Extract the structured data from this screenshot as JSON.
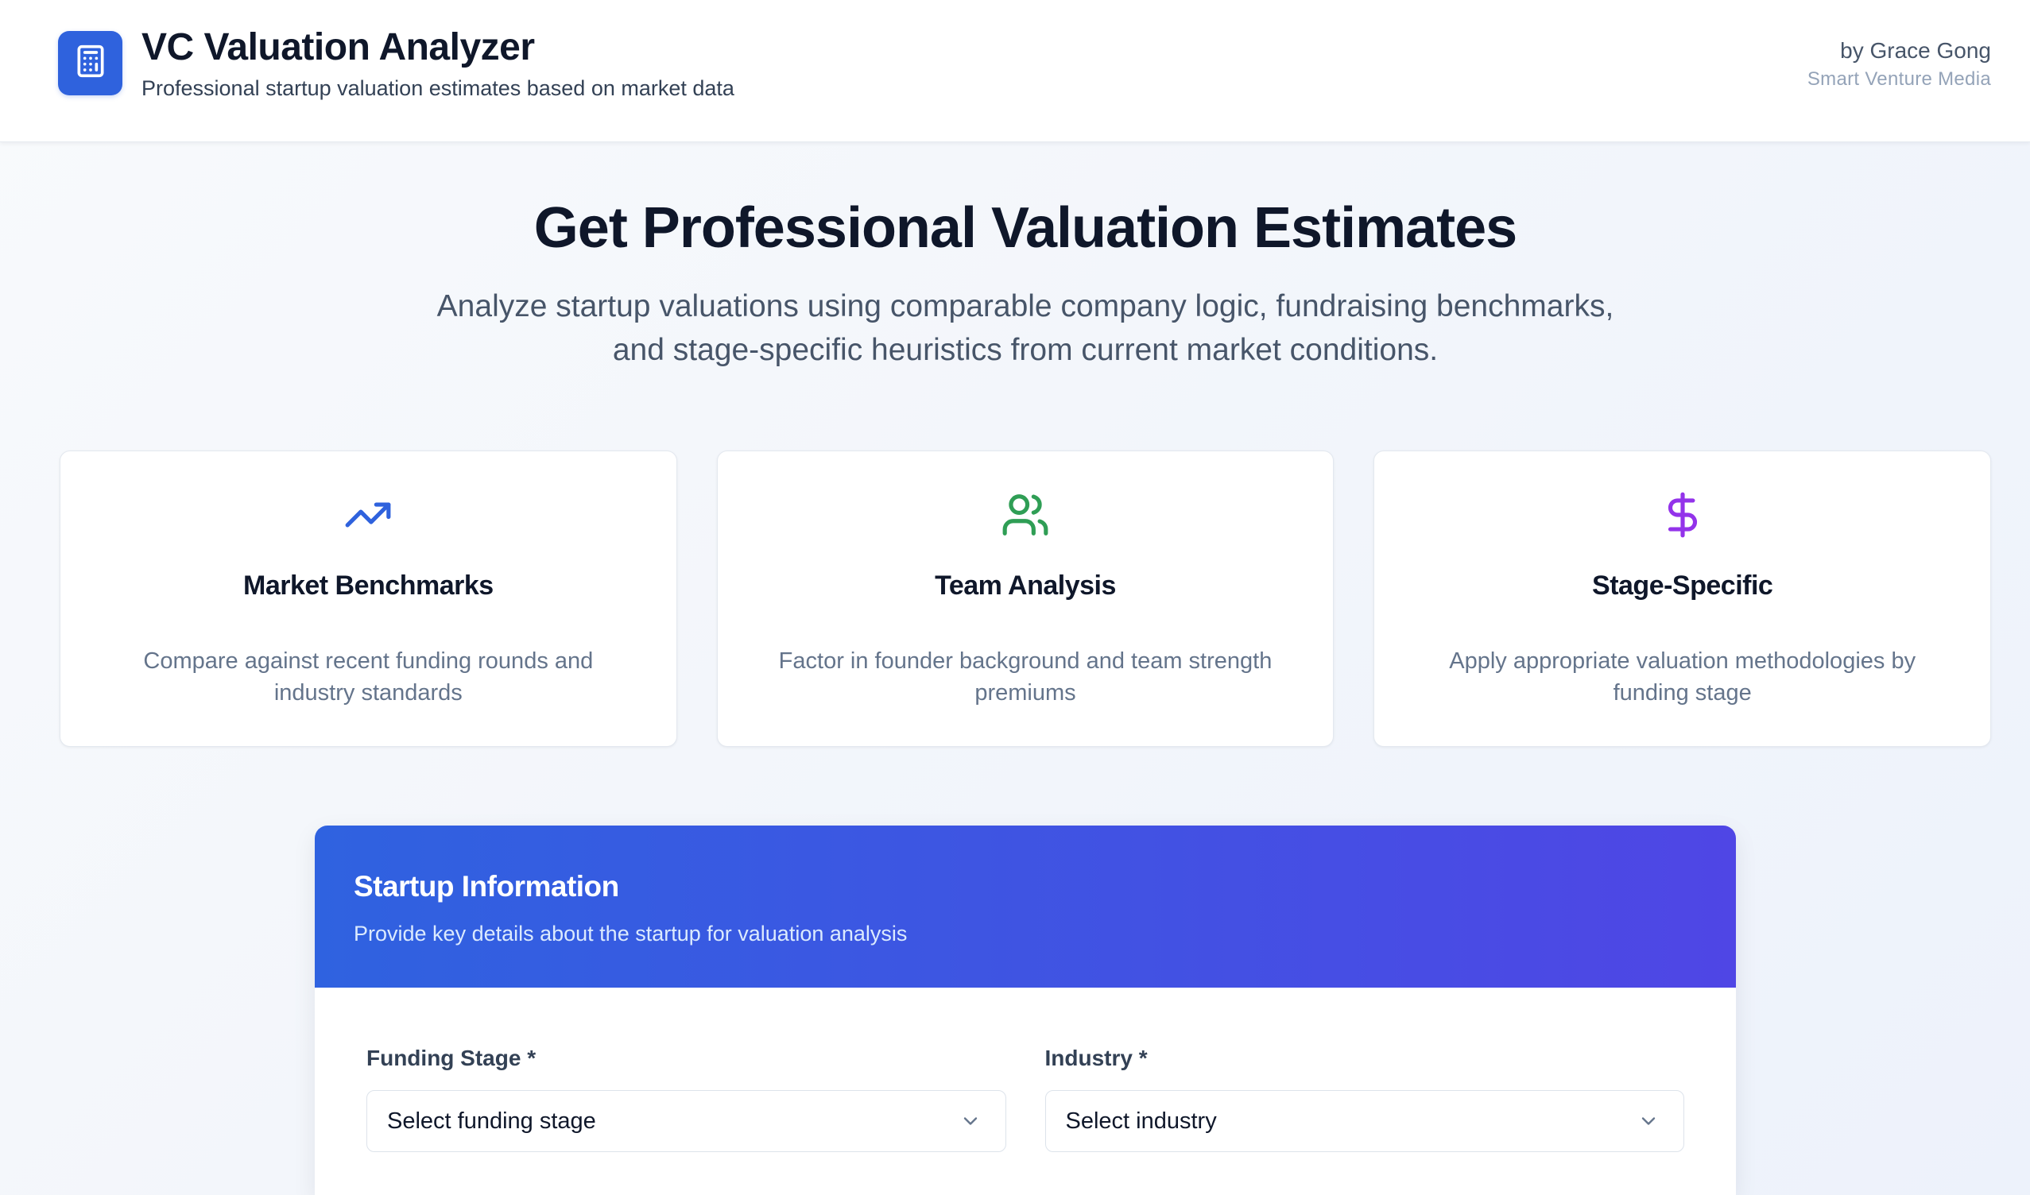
{
  "theme": {
    "primary": "#2f62dd",
    "gradient_start": "#2f62e0",
    "gradient_end": "#4f46e5"
  },
  "header": {
    "logo_icon": "calculator-icon",
    "title": "VC Valuation Analyzer",
    "subtitle": "Professional startup valuation estimates based on market data",
    "author": "by Grace Gong",
    "company": "Smart Venture Media"
  },
  "hero": {
    "title": "Get Professional Valuation Estimates",
    "description": [
      "Analyze startup valuations using comparable company logic, fundraising benchmarks,",
      "and stage-specific heuristics from current market conditions."
    ]
  },
  "features": [
    {
      "icon": "trending-up-icon",
      "icon_color": "#2f62dd",
      "title": "Market Benchmarks",
      "description": "Compare against recent funding rounds and industry standards"
    },
    {
      "icon": "users-icon",
      "icon_color": "#2f9e55",
      "title": "Team Analysis",
      "description": "Factor in founder background and team strength premiums"
    },
    {
      "icon": "dollar-sign-icon",
      "icon_color": "#9333ea",
      "title": "Stage-Specific",
      "description": "Apply appropriate valuation methodologies by funding stage"
    }
  ],
  "form": {
    "title": "Startup Information",
    "subtitle": "Provide key details about the startup for valuation analysis",
    "fields": [
      {
        "label": "Funding Stage *",
        "value": "Select funding stage",
        "icon": "chevron-down-icon"
      },
      {
        "label": "Industry *",
        "value": "Select industry",
        "icon": "chevron-down-icon"
      }
    ]
  }
}
